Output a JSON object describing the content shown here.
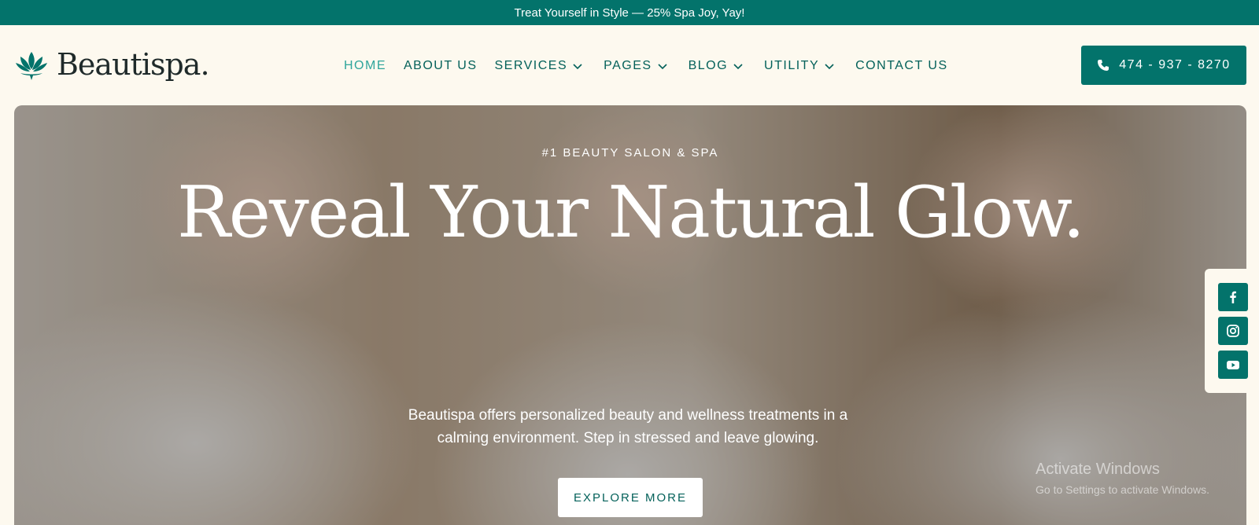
{
  "promo": {
    "text": "Treat Yourself in Style — 25% Spa Joy, Yay!"
  },
  "brand": {
    "name": "Beautispa.",
    "accent": "#03736b",
    "logo_icon": "lotus-icon"
  },
  "nav": {
    "items": [
      {
        "label": "HOME",
        "active": true,
        "dropdown": false
      },
      {
        "label": "ABOUT US",
        "dropdown": false
      },
      {
        "label": "SERVICES",
        "dropdown": true
      },
      {
        "label": "PAGES",
        "dropdown": true
      },
      {
        "label": "BLOG",
        "dropdown": true
      },
      {
        "label": "UTILITY",
        "dropdown": true
      },
      {
        "label": "CONTACT US",
        "dropdown": false
      }
    ]
  },
  "contact": {
    "phone": "474 - 937 - 8270",
    "icon": "phone-icon"
  },
  "hero": {
    "eyebrow": "#1 BEAUTY SALON & SPA",
    "headline": "Reveal Your Natural Glow.",
    "description": "Beautispa offers personalized beauty and wellness treatments in a calming environment. Step in stressed and leave glowing.",
    "cta": "EXPLORE MORE"
  },
  "social": [
    "facebook-icon",
    "instagram-icon",
    "youtube-icon"
  ],
  "os_watermark": {
    "line1": "Activate Windows",
    "line2": "Go to Settings to activate Windows."
  }
}
